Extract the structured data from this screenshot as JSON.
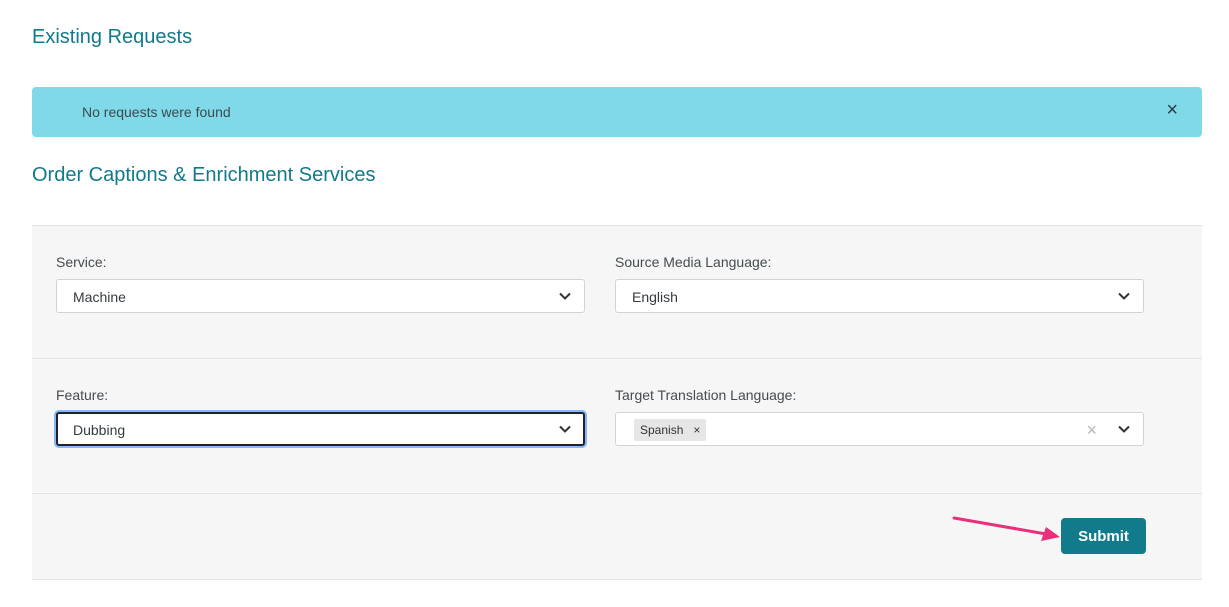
{
  "existing_requests": {
    "title": "Existing Requests",
    "alert": {
      "message": "No requests were found",
      "close_icon": "close-icon",
      "color": "#80d9e8"
    }
  },
  "order": {
    "title": "Order Captions & Enrichment Services",
    "service": {
      "label": "Service:",
      "value": "Machine"
    },
    "source_language": {
      "label": "Source Media Language:",
      "value": "English"
    },
    "feature": {
      "label": "Feature:",
      "value": "Dubbing"
    },
    "target_language": {
      "label": "Target Translation Language:",
      "tags": [
        "Spanish"
      ],
      "tag_remove_glyph": "×",
      "clear_glyph": "×"
    },
    "submit_label": "Submit"
  },
  "colors": {
    "accent": "#117a8b",
    "annotation_arrow": "#e8317a",
    "panel_bg": "#f6f6f6"
  }
}
